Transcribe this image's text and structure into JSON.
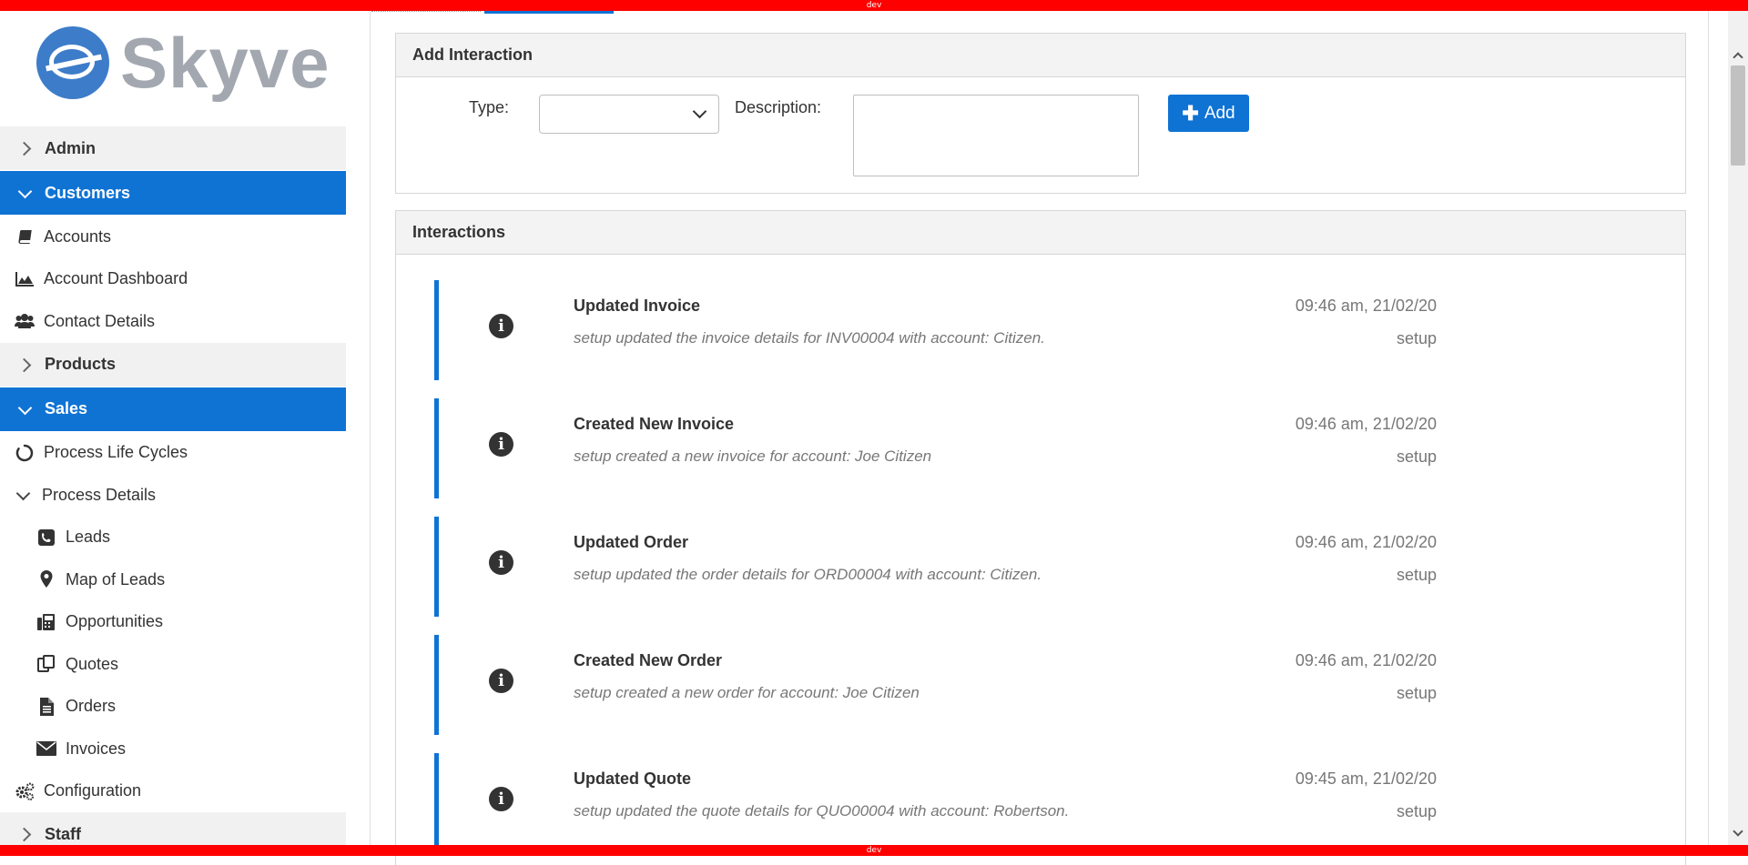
{
  "env_label": "dev",
  "brand": {
    "name": "Skyve"
  },
  "sidebar": {
    "groups": [
      {
        "label": "Admin"
      },
      {
        "label": "Customers"
      },
      {
        "label": "Products"
      },
      {
        "label": "Sales"
      },
      {
        "label": "Staff"
      }
    ],
    "customers_items": [
      {
        "label": "Accounts",
        "icon": "book-icon"
      },
      {
        "label": "Account Dashboard",
        "icon": "area-chart-icon"
      },
      {
        "label": "Contact Details",
        "icon": "users-icon"
      }
    ],
    "sales_items": [
      {
        "label": "Process Life Cycles",
        "icon": "circle-notch-icon"
      },
      {
        "label": "Process Details",
        "icon": "chevron-down-icon"
      }
    ],
    "process_details_items": [
      {
        "label": "Leads",
        "icon": "phone-icon"
      },
      {
        "label": "Map of Leads",
        "icon": "map-marker-icon"
      },
      {
        "label": "Opportunities",
        "icon": "fax-icon"
      },
      {
        "label": "Quotes",
        "icon": "copy-icon"
      },
      {
        "label": "Orders",
        "icon": "file-text-icon"
      },
      {
        "label": "Invoices",
        "icon": "envelope-icon"
      }
    ],
    "configuration": {
      "label": "Configuration",
      "icon": "cogs-icon"
    }
  },
  "add_interaction": {
    "title": "Add Interaction",
    "type_label": "Type:",
    "type_value": "",
    "description_label": "Description:",
    "description_value": "",
    "add_label": "Add"
  },
  "interactions": {
    "title": "Interactions",
    "entries": [
      {
        "title": "Updated Invoice",
        "description": "setup updated the invoice details for INV00004 with account: Citizen.",
        "time": "09:46 am, 21/02/20",
        "user": "setup"
      },
      {
        "title": "Created New Invoice",
        "description": "setup created a new invoice for account: Joe Citizen",
        "time": "09:46 am, 21/02/20",
        "user": "setup"
      },
      {
        "title": "Updated Order",
        "description": "setup updated the order details for ORD00004 with account: Citizen.",
        "time": "09:46 am, 21/02/20",
        "user": "setup"
      },
      {
        "title": "Created New Order",
        "description": "setup created a new order for account: Joe Citizen",
        "time": "09:46 am, 21/02/20",
        "user": "setup"
      },
      {
        "title": "Updated Quote",
        "description": "setup updated the quote details for QUO00004 with account: Robertson.",
        "time": "09:45 am, 21/02/20",
        "user": "setup"
      }
    ]
  },
  "colors": {
    "accent": "#0f73d4",
    "dev_bar": "#ff0000",
    "logo": "#3d7cc9",
    "logo_text": "#a3a8b0"
  }
}
